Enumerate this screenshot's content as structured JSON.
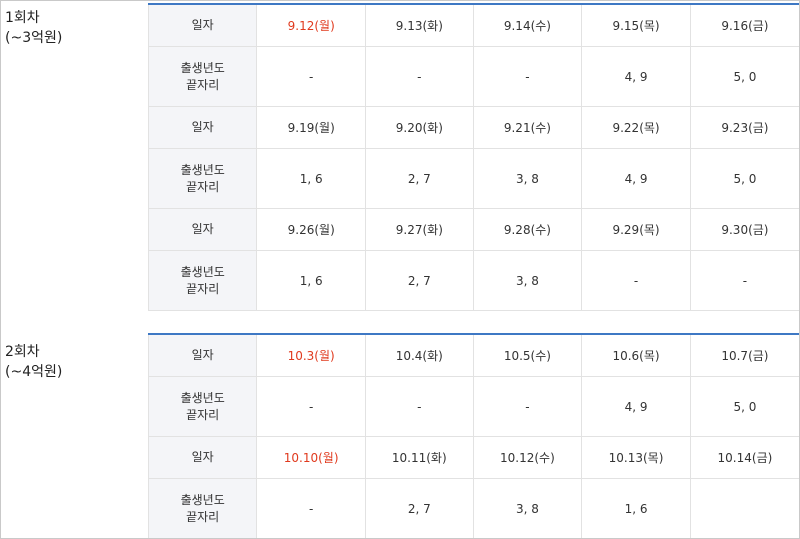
{
  "rounds": [
    {
      "label_line1": "1회차",
      "label_line2": "(~3억원)",
      "rows": [
        {
          "kind": "date",
          "header": "일자",
          "cells": [
            "9.12(월)",
            "9.13(화)",
            "9.14(수)",
            "9.15(목)",
            "9.16(금)"
          ],
          "red": [
            true,
            false,
            false,
            false,
            false
          ]
        },
        {
          "kind": "num",
          "header_line1": "출생년도",
          "header_line2": "끝자리",
          "cells": [
            "-",
            "-",
            "-",
            "4, 9",
            "5, 0"
          ]
        },
        {
          "kind": "date",
          "header": "일자",
          "cells": [
            "9.19(월)",
            "9.20(화)",
            "9.21(수)",
            "9.22(목)",
            "9.23(금)"
          ],
          "red": [
            false,
            false,
            false,
            false,
            false
          ]
        },
        {
          "kind": "num",
          "header_line1": "출생년도",
          "header_line2": "끝자리",
          "cells": [
            "1, 6",
            "2, 7",
            "3, 8",
            "4, 9",
            "5, 0"
          ]
        },
        {
          "kind": "date",
          "header": "일자",
          "cells": [
            "9.26(월)",
            "9.27(화)",
            "9.28(수)",
            "9.29(목)",
            "9.30(금)"
          ],
          "red": [
            false,
            false,
            false,
            false,
            false
          ]
        },
        {
          "kind": "num",
          "header_line1": "출생년도",
          "header_line2": "끝자리",
          "cells": [
            "1, 6",
            "2, 7",
            "3, 8",
            "-",
            "-"
          ]
        }
      ]
    },
    {
      "label_line1": "2회차",
      "label_line2": "(~4억원)",
      "rows": [
        {
          "kind": "date",
          "header": "일자",
          "cells": [
            "10.3(월)",
            "10.4(화)",
            "10.5(수)",
            "10.6(목)",
            "10.7(금)"
          ],
          "red": [
            true,
            false,
            false,
            false,
            false
          ]
        },
        {
          "kind": "num",
          "header_line1": "출생년도",
          "header_line2": "끝자리",
          "cells": [
            "-",
            "-",
            "-",
            "4, 9",
            "5, 0"
          ]
        },
        {
          "kind": "date",
          "header": "일자",
          "cells": [
            "10.10(월)",
            "10.11(화)",
            "10.12(수)",
            "10.13(목)",
            "10.14(금)"
          ],
          "red": [
            true,
            false,
            false,
            false,
            false
          ]
        },
        {
          "kind": "num",
          "header_line1": "출생년도",
          "header_line2": "끝자리",
          "cells": [
            "-",
            "2, 7",
            "3, 8",
            "1, 6",
            ""
          ]
        }
      ]
    }
  ],
  "colors": {
    "accent_border": "#3e78c4",
    "holiday_red": "#e03a1e",
    "header_bg": "#f4f5f8"
  }
}
